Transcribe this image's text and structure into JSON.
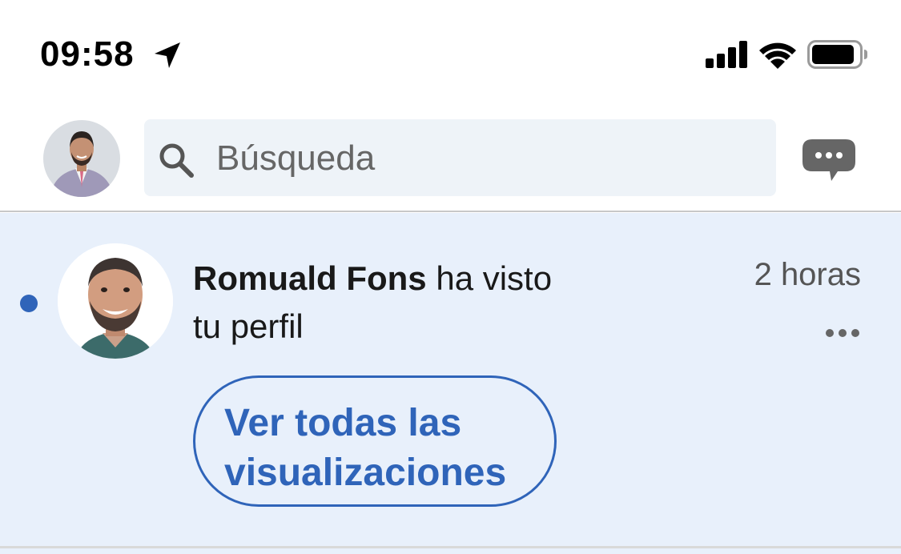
{
  "status_bar": {
    "time": "09:58",
    "icons": [
      "location-arrow-icon",
      "cellular-signal-icon",
      "wifi-icon",
      "battery-icon"
    ]
  },
  "header": {
    "search": {
      "placeholder": "Búsqueda",
      "value": ""
    },
    "icons": [
      "profile-avatar",
      "search-icon",
      "messages-icon"
    ]
  },
  "notification": {
    "unread": true,
    "actor_name": "Romuald Fons",
    "text_line1": " ha visto",
    "text_line2": "tu perfil",
    "time_ago": "2 horas",
    "cta_label": "Ver todas las visualizaciones",
    "icons": [
      "actor-avatar",
      "more-options-icon"
    ]
  },
  "colors": {
    "accent": "#2f64b9",
    "card_background": "#e8f0fb",
    "search_background": "#eef3f8",
    "messages_icon": "#666666"
  }
}
